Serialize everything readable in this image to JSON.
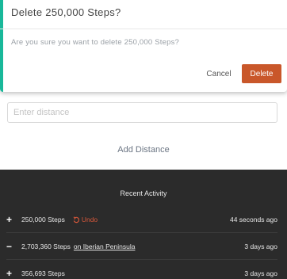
{
  "form": {
    "distance_placeholder": "Enter distance",
    "add_label": "Add Distance"
  },
  "activity": {
    "title": "Recent Activity",
    "items": [
      {
        "sign": "+",
        "text": "250,000 Steps",
        "place": "",
        "undo_label": "Undo",
        "time": "44 seconds ago"
      },
      {
        "sign": "−",
        "text": "2,703,360 Steps",
        "place_prefix": "on",
        "place": "Iberian Peninsula",
        "time": "3 days ago"
      },
      {
        "sign": "+",
        "text": "356,693 Steps",
        "place": "",
        "time": "3 days ago"
      }
    ]
  },
  "modal": {
    "title": "Delete 250,000 Steps?",
    "body": "Are you sure you want to delete 250,000 Steps?",
    "cancel_label": "Cancel",
    "delete_label": "Delete",
    "accent_color": "#19b89a",
    "delete_color": "#c9572a"
  },
  "colors": {
    "undo": "#d6573a",
    "panel_bg": "#2b2b2b"
  }
}
